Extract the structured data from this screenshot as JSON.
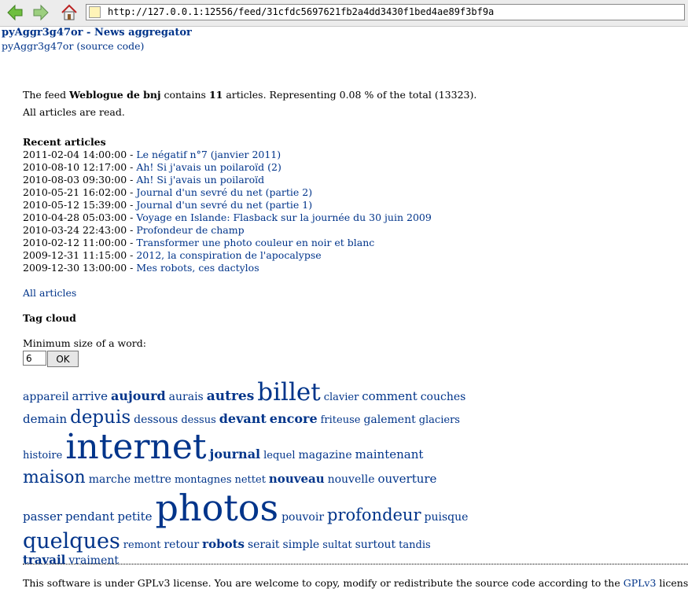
{
  "browser": {
    "url": "http://127.0.0.1:12556/feed/31cfdc5697621fb2a4dd3430f1bed4ae89f3bf9a"
  },
  "header": {
    "title": "pyAggr3g47or - News aggregator",
    "source_link": "pyAggr3g47or (source code)"
  },
  "summary": {
    "prefix": "The feed ",
    "feed_name": "Weblogue de bnj",
    "middle": " contains ",
    "count": "11",
    "suffix": " articles. Representing 0.08 % of the total (13323).",
    "read_status": "All articles are read."
  },
  "recent": {
    "title": "Recent articles",
    "items": [
      {
        "date": "2011-02-04 14:00:00 - ",
        "title": "Le négatif n°7 (janvier 2011)"
      },
      {
        "date": "2010-08-10 12:17:00 - ",
        "title": "Ah! Si j'avais un poilaroïd (2)"
      },
      {
        "date": "2010-08-03 09:30:00 - ",
        "title": "Ah! Si j'avais un poilaroïd"
      },
      {
        "date": "2010-05-21 16:02:00 - ",
        "title": "Journal d'un sevré du net (partie 2)"
      },
      {
        "date": "2010-05-12 15:39:00 - ",
        "title": "Journal d'un sevré du net (partie 1)"
      },
      {
        "date": "2010-04-28 05:03:00 - ",
        "title": "Voyage en Islande: Flasback sur la journée du 30 juin 2009"
      },
      {
        "date": "2010-03-24 22:43:00 - ",
        "title": "Profondeur de champ"
      },
      {
        "date": "2010-02-12 11:00:00 - ",
        "title": "Transformer une photo couleur en noir et blanc"
      },
      {
        "date": "2009-12-31 11:15:00 - ",
        "title": "2012, la conspiration de l'apocalypse"
      },
      {
        "date": "2009-12-30 13:00:00 - ",
        "title": "Mes robots, ces dactylos"
      }
    ],
    "all_articles": "All articles"
  },
  "tag_cloud": {
    "title": "Tag cloud",
    "min_label": "Minimum size of a word:",
    "min_value": "6",
    "ok_label": "OK",
    "words": [
      {
        "w": "appareil",
        "s": 14,
        "b": false
      },
      {
        "w": "arrive",
        "s": 15,
        "b": false
      },
      {
        "w": "aujourd",
        "s": 16,
        "b": true
      },
      {
        "w": "aurais",
        "s": 14,
        "b": false
      },
      {
        "w": "autres",
        "s": 17,
        "b": true
      },
      {
        "w": "billet",
        "s": 31,
        "b": false
      },
      {
        "w": "clavier",
        "s": 13,
        "b": false
      },
      {
        "w": "comment",
        "s": 15,
        "b": false
      },
      {
        "w": "couches",
        "s": 14,
        "b": false
      },
      {
        "w": "demain",
        "s": 15,
        "b": false
      },
      {
        "w": "depuis",
        "s": 23,
        "b": false
      },
      {
        "w": "dessous",
        "s": 14,
        "b": false
      },
      {
        "w": "dessus",
        "s": 13,
        "b": false
      },
      {
        "w": "devant",
        "s": 16,
        "b": true
      },
      {
        "w": "encore",
        "s": 16,
        "b": true
      },
      {
        "w": "friteuse",
        "s": 13,
        "b": false
      },
      {
        "w": "galement",
        "s": 14,
        "b": false
      },
      {
        "w": "glaciers",
        "s": 13,
        "b": false
      },
      {
        "w": "histoire",
        "s": 13,
        "b": false
      },
      {
        "w": "internet",
        "s": 44,
        "b": false
      },
      {
        "w": "journal",
        "s": 16,
        "b": true
      },
      {
        "w": "lequel",
        "s": 13,
        "b": false
      },
      {
        "w": "magazine",
        "s": 14,
        "b": false
      },
      {
        "w": "maintenant",
        "s": 15,
        "b": false
      },
      {
        "w": "maison",
        "s": 22,
        "b": false
      },
      {
        "w": "marche",
        "s": 14,
        "b": false
      },
      {
        "w": "mettre",
        "s": 14,
        "b": false
      },
      {
        "w": "montagnes",
        "s": 13,
        "b": false
      },
      {
        "w": "nettet",
        "s": 13,
        "b": false
      },
      {
        "w": "nouveau",
        "s": 15,
        "b": true
      },
      {
        "w": "nouvelle",
        "s": 14,
        "b": false
      },
      {
        "w": "ouverture",
        "s": 15,
        "b": false
      },
      {
        "w": "passer",
        "s": 15,
        "b": false
      },
      {
        "w": "pendant",
        "s": 15,
        "b": false
      },
      {
        "w": "petite",
        "s": 15,
        "b": false
      },
      {
        "w": "photos",
        "s": 46,
        "b": false
      },
      {
        "w": "pouvoir",
        "s": 14,
        "b": false
      },
      {
        "w": "profondeur",
        "s": 21,
        "b": false
      },
      {
        "w": "puisque",
        "s": 14,
        "b": false
      },
      {
        "w": "quelques",
        "s": 27,
        "b": false
      },
      {
        "w": "remont",
        "s": 13,
        "b": false
      },
      {
        "w": "retour",
        "s": 14,
        "b": false
      },
      {
        "w": "robots",
        "s": 15,
        "b": true
      },
      {
        "w": "serait",
        "s": 14,
        "b": false
      },
      {
        "w": "simple",
        "s": 14,
        "b": false
      },
      {
        "w": "sultat",
        "s": 13,
        "b": false
      },
      {
        "w": "surtout",
        "s": 14,
        "b": false
      },
      {
        "w": "tandis",
        "s": 13,
        "b": false
      },
      {
        "w": "travail",
        "s": 15,
        "b": true
      },
      {
        "w": "vraiment",
        "s": 14,
        "b": false
      }
    ]
  },
  "footer": {
    "text_before": "This software is under GPLv3 license. You are welcome to copy, modify or redistribute the source code according to the ",
    "link": "GPLv3",
    "text_after": " license."
  }
}
